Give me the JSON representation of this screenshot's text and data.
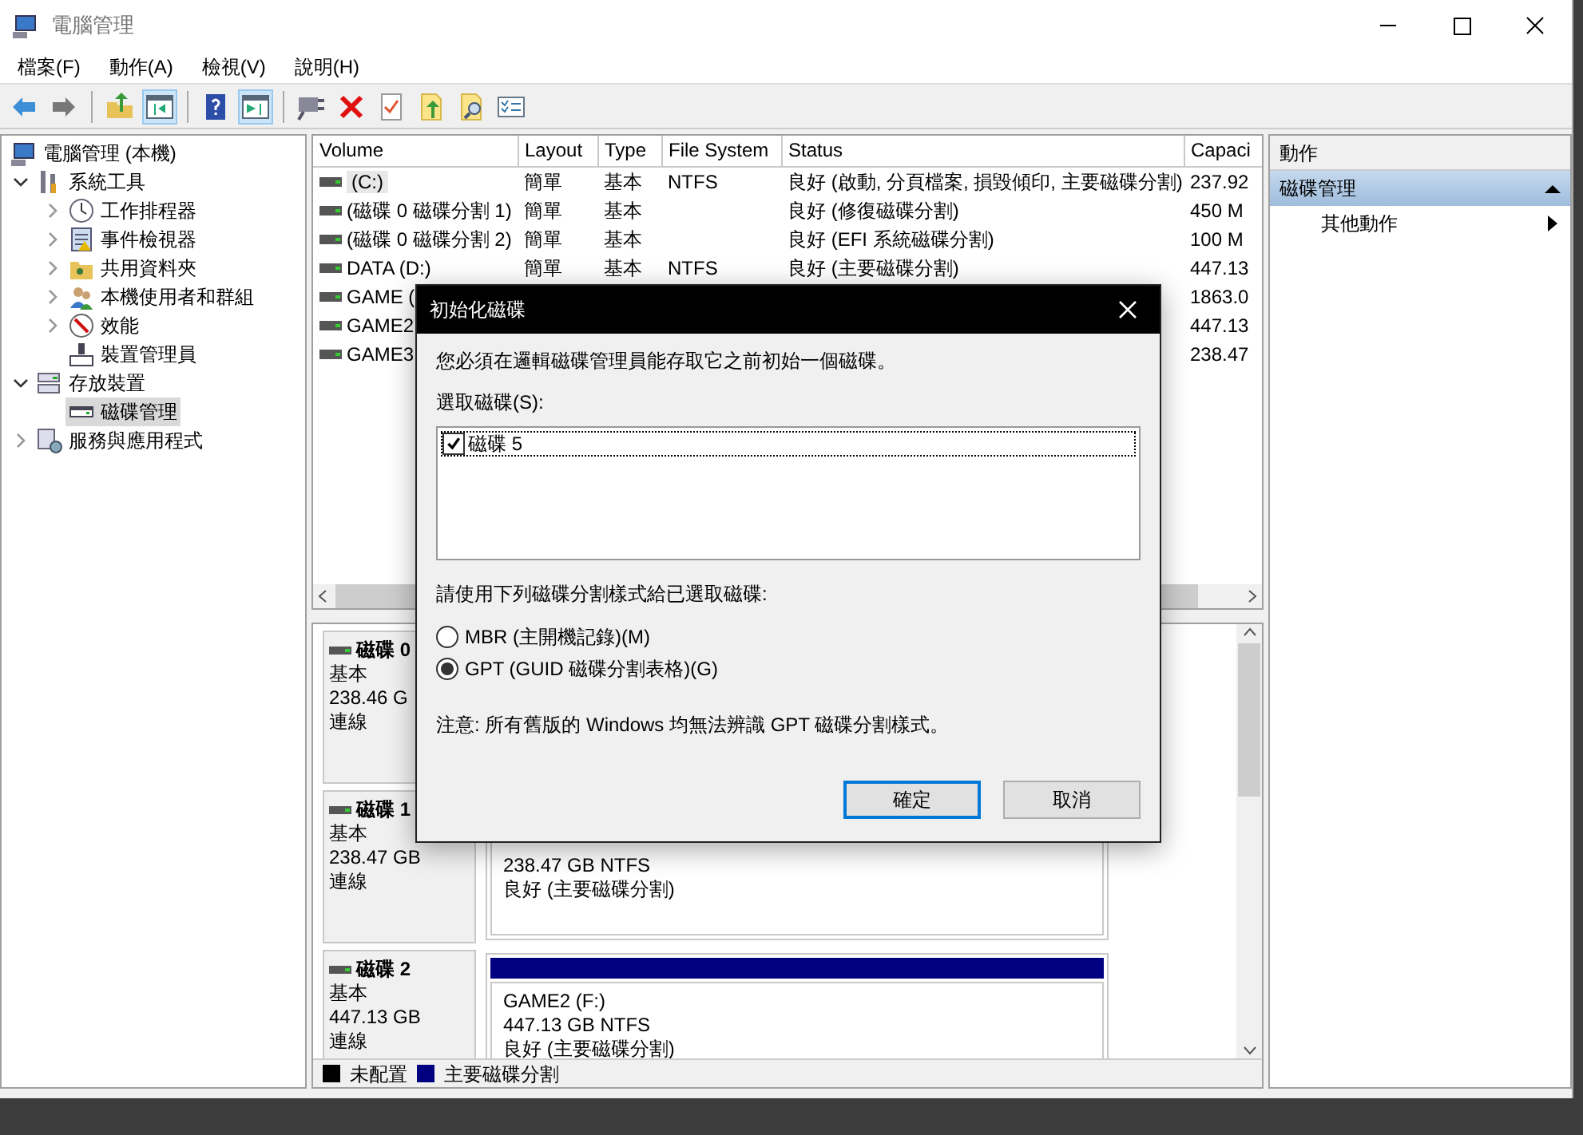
{
  "window": {
    "title": "電腦管理"
  },
  "menu": [
    "檔案(F)",
    "動作(A)",
    "檢視(V)",
    "說明(H)"
  ],
  "toolbar": [
    [
      {
        "kind": "back",
        "pressed": false
      },
      {
        "kind": "forward",
        "pressed": false
      }
    ],
    [
      {
        "kind": "up-folder",
        "pressed": false
      },
      {
        "kind": "console-tree",
        "pressed": true
      }
    ],
    [
      {
        "kind": "help",
        "pressed": false
      },
      {
        "kind": "action-pane",
        "pressed": true
      }
    ],
    [
      {
        "kind": "connect",
        "pressed": false
      },
      {
        "kind": "delete",
        "pressed": false
      },
      {
        "kind": "properties",
        "pressed": false
      },
      {
        "kind": "export",
        "pressed": false
      },
      {
        "kind": "find",
        "pressed": false
      },
      {
        "kind": "checklist",
        "pressed": false
      }
    ]
  ],
  "tree": [
    {
      "label": "電腦管理 (本機)",
      "kind": "computer",
      "selected": false,
      "children": [
        {
          "label": "系統工具",
          "kind": "tools",
          "selected": false,
          "expanded": true,
          "children": [
            {
              "label": "工作排程器",
              "kind": "clock",
              "selected": false,
              "expanded": false
            },
            {
              "label": "事件檢視器",
              "kind": "log",
              "selected": false,
              "expanded": false
            },
            {
              "label": "共用資料夾",
              "kind": "folder",
              "selected": false,
              "expanded": false
            },
            {
              "label": "本機使用者和群組",
              "kind": "users",
              "selected": false,
              "expanded": false
            },
            {
              "label": "效能",
              "kind": "gauge",
              "selected": false,
              "expanded": false
            },
            {
              "label": "裝置管理員",
              "kind": "device",
              "selected": false
            }
          ]
        },
        {
          "label": "存放裝置",
          "kind": "storage",
          "selected": false,
          "expanded": true,
          "children": [
            {
              "label": "磁碟管理",
              "kind": "disk",
              "selected": true
            }
          ]
        },
        {
          "label": "服務與應用程式",
          "kind": "services",
          "selected": false,
          "expanded": false
        }
      ]
    }
  ],
  "volume_table": {
    "columns": [
      "Volume",
      "Layout",
      "Type",
      "File System",
      "Status",
      "Capaci"
    ],
    "rows": [
      {
        "volume": "(C:)",
        "layout": "簡單",
        "type": "基本",
        "file_system": "NTFS",
        "status": "良好 (啟動, 分頁檔案, 損毀傾印, 主要磁碟分割)",
        "capacity": "237.92",
        "selected": true
      },
      {
        "volume": "(磁碟 0 磁碟分割 1)",
        "layout": "簡單",
        "type": "基本",
        "status": "良好 (修復磁碟分割)",
        "capacity": "450 M",
        "selected": false
      },
      {
        "volume": "(磁碟 0 磁碟分割 2)",
        "layout": "簡單",
        "type": "基本",
        "status": "良好 (EFI 系統磁碟分割)",
        "capacity": "100 M",
        "selected": false
      },
      {
        "volume": "DATA (D:)",
        "layout": "簡單",
        "type": "基本",
        "file_system": "NTFS",
        "status": "良好 (主要磁碟分割)",
        "capacity": "447.13",
        "selected": false
      },
      {
        "volume": "GAME (",
        "capacity": "1863.0",
        "selected": false
      },
      {
        "volume": "GAME2",
        "capacity": "447.13",
        "selected": false
      },
      {
        "volume": "GAME3",
        "capacity": "238.47",
        "selected": false
      }
    ]
  },
  "disks": [
    {
      "name": "磁碟 0",
      "type": "基本",
      "size": "238.46 G",
      "state": "連線"
    },
    {
      "name": "磁碟 1",
      "type": "基本",
      "size": "238.47 GB",
      "state": "連線",
      "partitions": [
        {
          "size_fs": "238.47 GB NTFS",
          "status": "良好 (主要磁碟分割)"
        }
      ]
    },
    {
      "name": "磁碟 2",
      "type": "基本",
      "size": "447.13 GB",
      "state": "連線",
      "partitions": [
        {
          "label": "GAME2  (F:)",
          "size_fs": "447.13 GB NTFS",
          "status": "良好 (主要磁碟分割)",
          "color": "#000080"
        }
      ]
    }
  ],
  "legend": [
    {
      "label": "未配置",
      "color": "#000000"
    },
    {
      "label": "主要磁碟分割",
      "color": "#000080"
    }
  ],
  "actions": {
    "title": "動作",
    "sections": [
      {
        "label": "磁碟管理",
        "expanded": true,
        "items": [
          {
            "label": "其他動作"
          }
        ]
      }
    ]
  },
  "dialog": {
    "title": "初始化磁碟",
    "message": "您必須在邏輯磁碟管理員能存取它之前初始一個磁碟。",
    "disk_list_label": "選取磁碟(S):",
    "disk_list": [
      {
        "label": "磁碟 5",
        "checked": true
      }
    ],
    "style_label": "請使用下列磁碟分割樣式給已選取磁碟:",
    "options": [
      {
        "label": "MBR (主開機記錄)(M)",
        "selected": false
      },
      {
        "label": "GPT (GUID 磁碟分割表格)(G)",
        "selected": true
      }
    ],
    "note": "注意: 所有舊版的 Windows 均無法辨識 GPT 磁碟分割樣式。",
    "buttons": [
      {
        "label": "確定",
        "default": true
      },
      {
        "label": "取消",
        "default": false
      }
    ]
  }
}
